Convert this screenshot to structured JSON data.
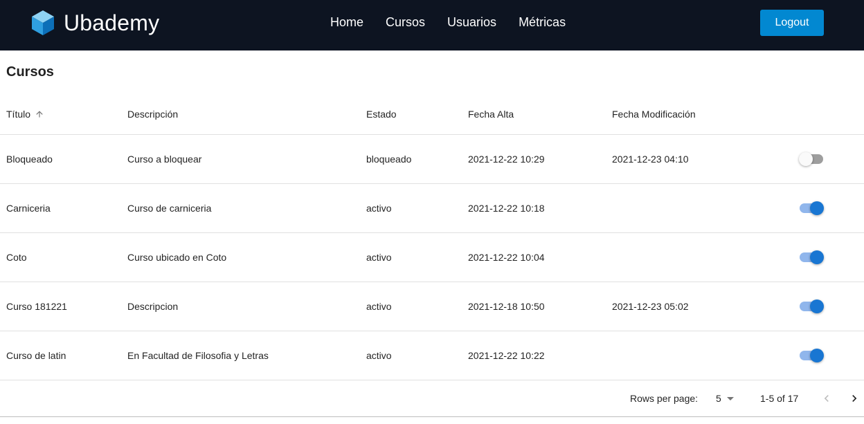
{
  "app": {
    "name": "Ubademy",
    "logo_icon": "hexagon-cube-logo"
  },
  "nav": {
    "links": [
      "Home",
      "Cursos",
      "Usuarios",
      "Métricas"
    ],
    "logout_label": "Logout"
  },
  "colors": {
    "navbar_bg": "#0d1421",
    "logout_bg": "#0288d1",
    "switch_on": "#1976d2",
    "switch_on_track": "#90b6ec",
    "switch_off_track": "#9e9e9e"
  },
  "page": {
    "title": "Cursos"
  },
  "table": {
    "columns": [
      "Título",
      "Descripción",
      "Estado",
      "Fecha Alta",
      "Fecha Modificación"
    ],
    "sort": {
      "column": "Título",
      "direction": "asc",
      "icon": "arrow-up-icon"
    },
    "rows": [
      {
        "titulo": "Bloqueado",
        "descripcion": "Curso a bloquear",
        "estado": "bloqueado",
        "fecha_alta": "2021-12-22 10:29",
        "fecha_modificacion": "2021-12-23 04:10",
        "enabled": false
      },
      {
        "titulo": "Carniceria",
        "descripcion": "Curso de carniceria",
        "estado": "activo",
        "fecha_alta": "2021-12-22 10:18",
        "fecha_modificacion": "",
        "enabled": true
      },
      {
        "titulo": "Coto",
        "descripcion": "Curso ubicado en Coto",
        "estado": "activo",
        "fecha_alta": "2021-12-22 10:04",
        "fecha_modificacion": "",
        "enabled": true
      },
      {
        "titulo": "Curso 181221",
        "descripcion": "Descripcion",
        "estado": "activo",
        "fecha_alta": "2021-12-18 10:50",
        "fecha_modificacion": "2021-12-23 05:02",
        "enabled": true
      },
      {
        "titulo": "Curso de latin",
        "descripcion": "En Facultad de Filosofia y Letras",
        "estado": "activo",
        "fecha_alta": "2021-12-22 10:22",
        "fecha_modificacion": "",
        "enabled": true
      }
    ]
  },
  "pagination": {
    "rows_per_page_label": "Rows per page:",
    "rows_per_page": "5",
    "range": "1-5 of 17",
    "prev_icon": "chevron-left-icon",
    "next_icon": "chevron-right-icon",
    "prev_disabled": true,
    "next_disabled": false
  }
}
